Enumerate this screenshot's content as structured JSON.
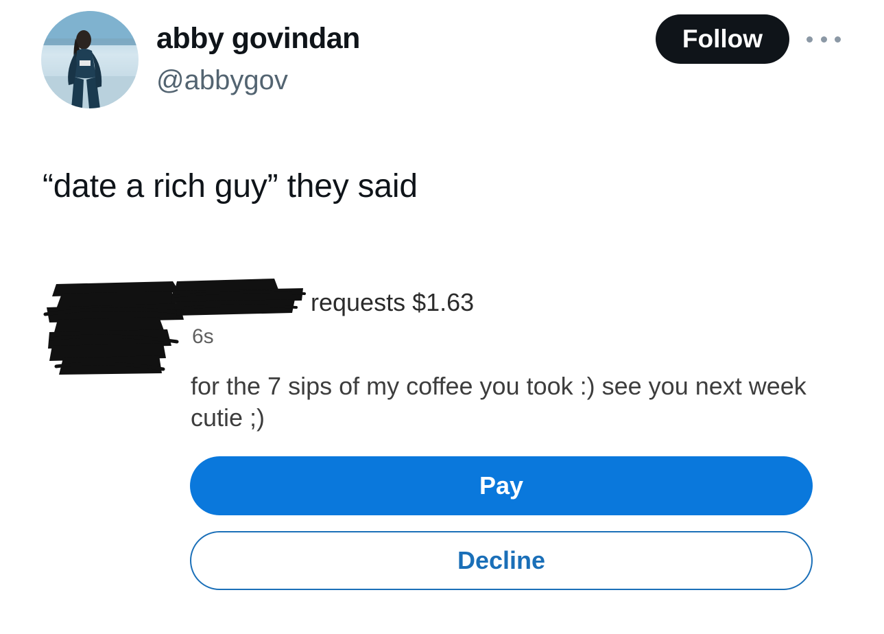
{
  "tweet": {
    "author": {
      "display_name": "abby govindan",
      "handle": "@abbygov"
    },
    "follow_label": "Follow",
    "more_icon": "more-dots-icon",
    "text": "“date a rich guy” they said"
  },
  "payment_request": {
    "request_text": "requests $1.63",
    "time_ago": "6s",
    "note": "for the 7 sips of my coffee you took :) see you next week cutie ;)",
    "pay_label": "Pay",
    "decline_label": "Decline"
  },
  "colors": {
    "follow_bg": "#0f1419",
    "pay_blue": "#0a78dc",
    "decline_outline": "#1a6fb8",
    "handle_gray": "#536471"
  }
}
